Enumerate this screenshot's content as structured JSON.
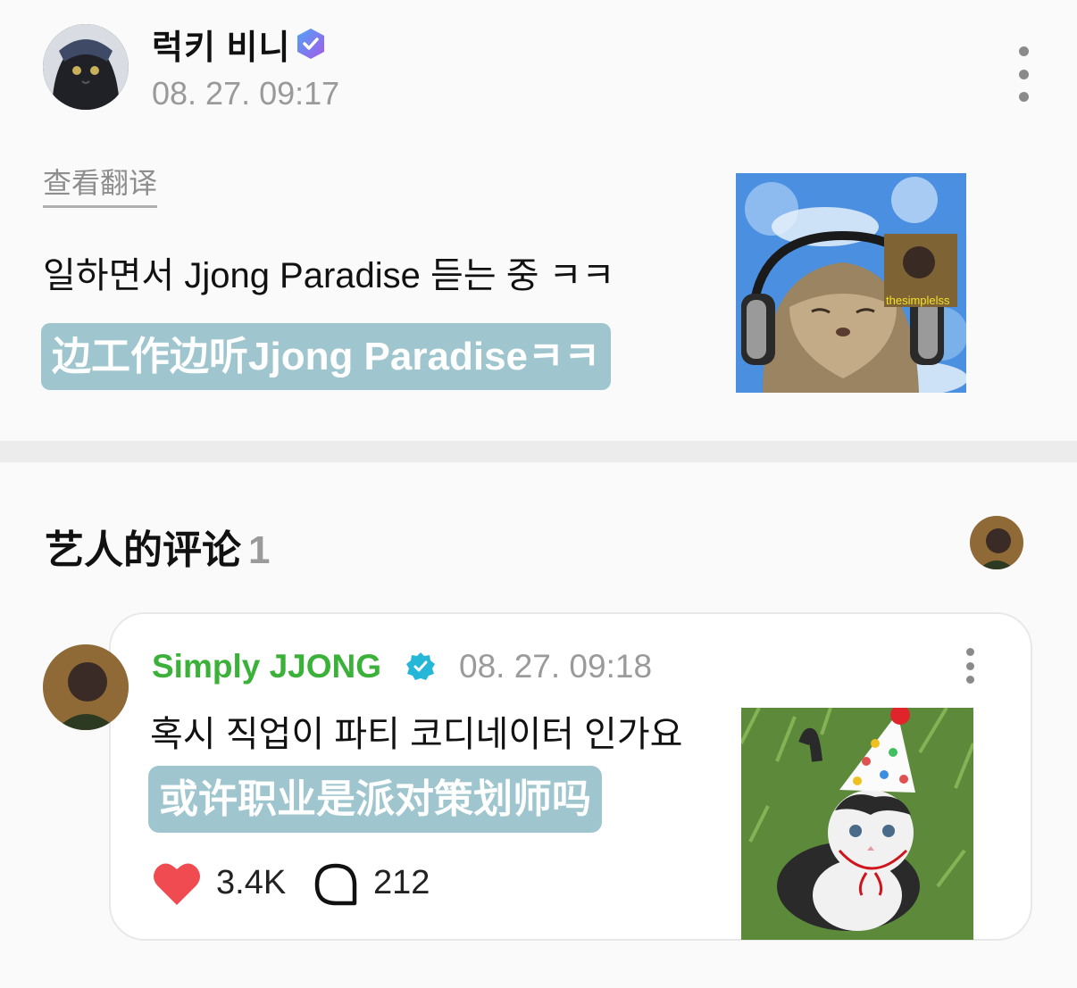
{
  "post": {
    "author_name": "럭키 비니",
    "timestamp": "08. 27. 09:17",
    "translate_link": "查看翻译",
    "text": "일하면서 Jjong Paradise 듣는 중 ㅋㅋ",
    "translation": "边工作边听Jjong Paradiseㅋㅋ",
    "image_caption": "thesimplelss"
  },
  "comments_section": {
    "title": "艺人的评论",
    "count": "1"
  },
  "comment": {
    "author_name": "Simply JJONG",
    "timestamp": "08. 27. 09:18",
    "text": "혹시 직업이 파티 코디네이터 인가요",
    "translation": "或许职业是派对策划师吗",
    "likes": "3.4K",
    "replies": "212"
  },
  "colors": {
    "verified_badge": "#7b6cf0",
    "commenter_name": "#3cb13a",
    "translation_bg": "#9fc6ce",
    "like_heart": "#f04b50"
  },
  "icons": {
    "more": "more-vertical-icon",
    "verified": "verified-badge-icon",
    "like": "heart-icon",
    "reply": "comment-bubble-icon"
  }
}
